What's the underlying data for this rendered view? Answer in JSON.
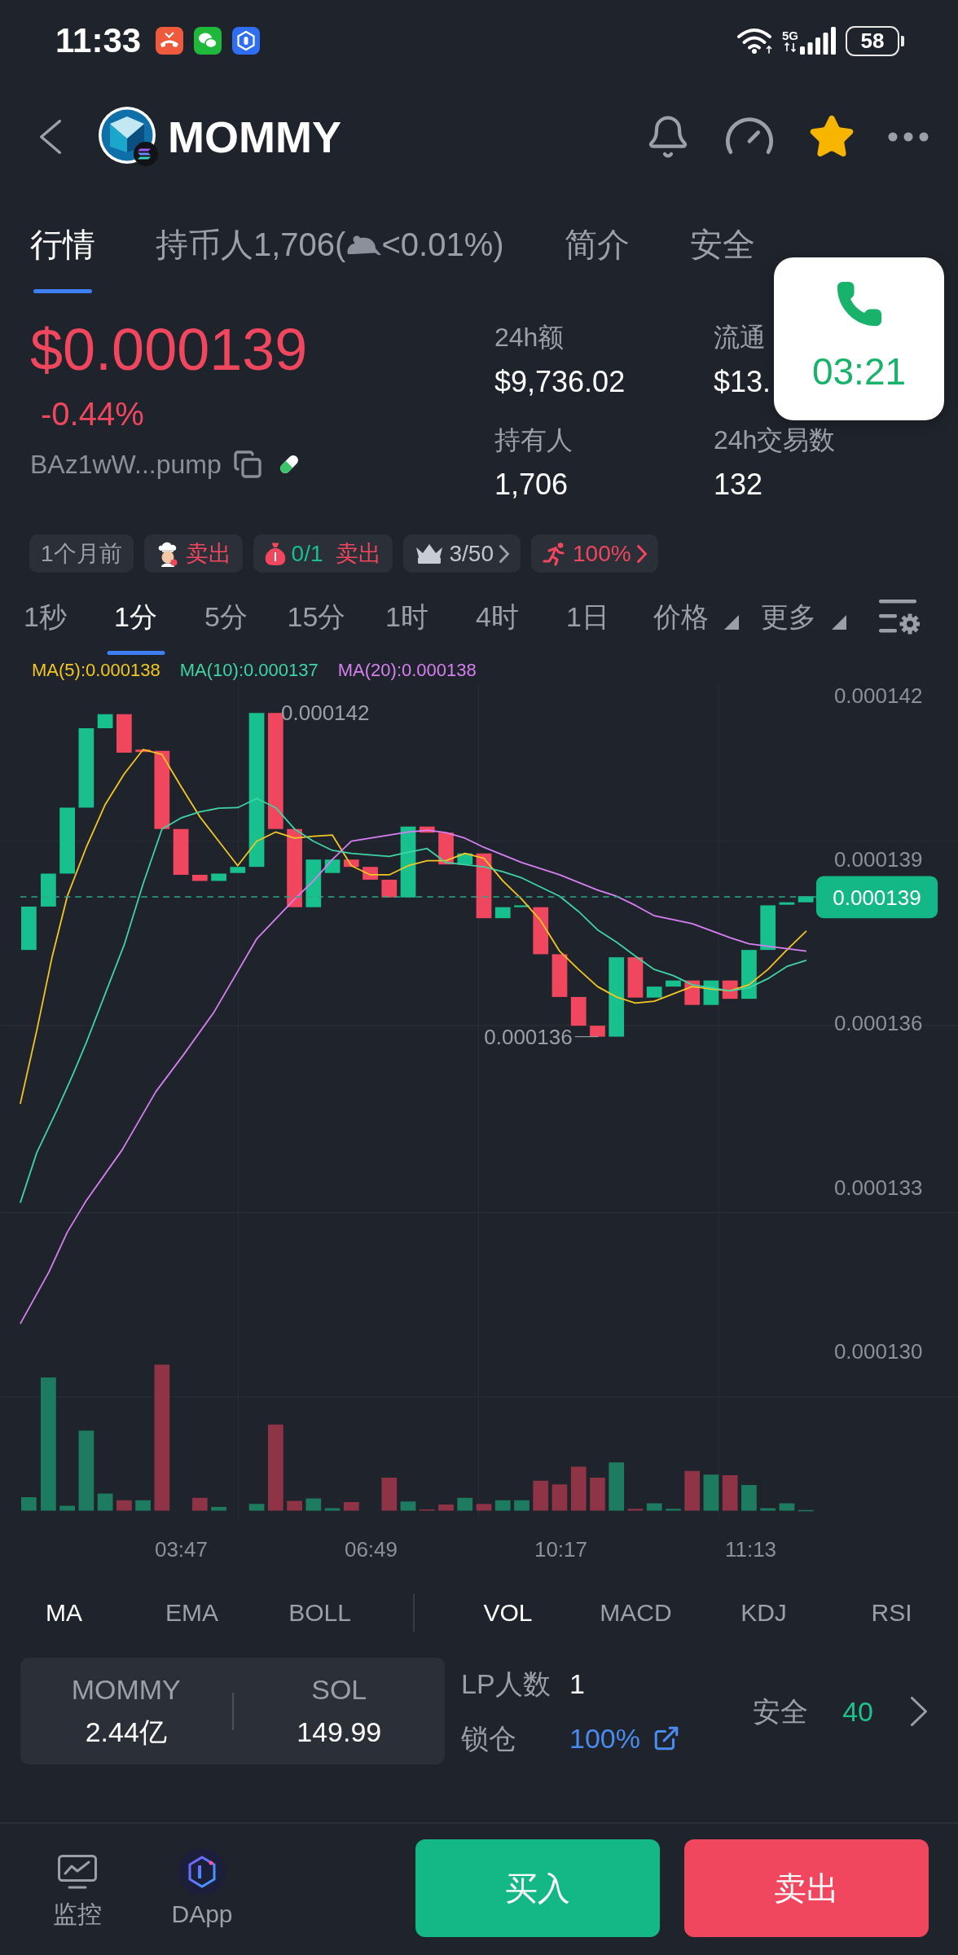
{
  "status_bar": {
    "time": "11:33",
    "network": "5G",
    "battery": "58"
  },
  "header": {
    "title": "MOMMY",
    "favorited": true
  },
  "tabs": [
    {
      "label": "行情",
      "selected": true
    },
    {
      "label": "持币人1,706(",
      "label_after_icon": "<0.01%)",
      "selected": false
    },
    {
      "label": "简介",
      "selected": false
    },
    {
      "label": "安全",
      "selected": false
    }
  ],
  "call_overlay": {
    "duration": "03:21"
  },
  "price": {
    "value": "$0.000139",
    "change": "-0.44%",
    "address": "BAz1wW...pump"
  },
  "stats": [
    {
      "label": "24h额",
      "value": "$9,736.02"
    },
    {
      "label": "流通",
      "value": "$13."
    },
    {
      "label": "持有人",
      "value": "1,706"
    },
    {
      "label": "24h交易数",
      "value": "132"
    }
  ],
  "badges": [
    {
      "kind": "age",
      "label": "1个月前"
    },
    {
      "kind": "dev",
      "label": "卖出"
    },
    {
      "kind": "sniper",
      "count": "0/1",
      "label": "卖出"
    },
    {
      "kind": "top",
      "label": "3/50"
    },
    {
      "kind": "insider",
      "label": "100%"
    }
  ],
  "intervals": [
    {
      "label": "1秒",
      "selected": false
    },
    {
      "label": "1分",
      "selected": true
    },
    {
      "label": "5分",
      "selected": false
    },
    {
      "label": "15分",
      "selected": false
    },
    {
      "label": "1时",
      "selected": false
    },
    {
      "label": "4时",
      "selected": false
    },
    {
      "label": "1日",
      "selected": false
    }
  ],
  "menus": [
    {
      "label": "价格"
    },
    {
      "label": "更多"
    }
  ],
  "ma_legend": [
    {
      "label": "MA(5):0.000138",
      "color": "#f3c623"
    },
    {
      "label": "MA(10):0.000137",
      "color": "#3fd3a6"
    },
    {
      "label": "MA(20):0.000138",
      "color": "#d77ff2"
    }
  ],
  "chart": {
    "price_axis": [
      "0.000142",
      "0.000139",
      "0.000136",
      "0.000133",
      "0.000130"
    ],
    "high_marker": "0.000142",
    "low_marker": "0.000136",
    "last_price": "0.000139",
    "time_axis": [
      "03:47",
      "06:49",
      "10:17",
      "11:13"
    ]
  },
  "indicators": {
    "main": [
      {
        "label": "MA",
        "selected": true
      },
      {
        "label": "EMA",
        "selected": false
      },
      {
        "label": "BOLL",
        "selected": false
      }
    ],
    "sub": [
      {
        "label": "VOL",
        "selected": true
      },
      {
        "label": "MACD",
        "selected": false
      },
      {
        "label": "KDJ",
        "selected": false
      },
      {
        "label": "RSI",
        "selected": false
      }
    ]
  },
  "liquidity": {
    "pool": [
      {
        "token": "MOMMY",
        "amount": "2.44亿"
      },
      {
        "token": "SOL",
        "amount": "149.99"
      }
    ],
    "lp_count": {
      "label": "LP人数",
      "value": "1"
    },
    "lock": {
      "label": "锁仓",
      "value": "100%"
    },
    "safety": {
      "label": "安全",
      "score": "40"
    }
  },
  "bottom_bar": {
    "shortcuts": [
      {
        "kind": "monitor",
        "label": "监控"
      },
      {
        "kind": "dapp",
        "label": "DApp"
      }
    ],
    "buy": "买入",
    "sell": "卖出"
  }
}
